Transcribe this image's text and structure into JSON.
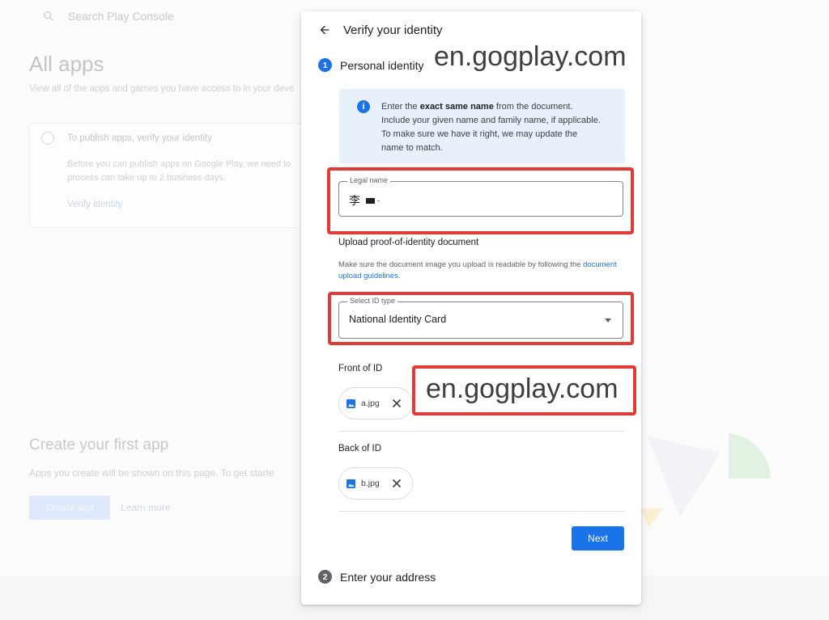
{
  "background": {
    "search_placeholder": "Search Play Console",
    "page_title": "All apps",
    "page_subtitle": "View all of the apps and games you have access to in your deve",
    "card": {
      "title": "To publish apps, verify your identity",
      "body": "Before you can publish apps on Google Play, we need to process can take up to 2 business days.",
      "link": "Verify identity"
    },
    "create_title": "Create your first app",
    "create_sub": "Apps you create will be shown on this page. To get starte",
    "create_button": "Create app",
    "learn_more": "Learn more"
  },
  "dialog": {
    "title": "Verify your identity",
    "step1": {
      "number": "1",
      "label": "Personal identity"
    },
    "info": {
      "pre": "Enter the ",
      "bold": "exact same name",
      "post": " from the document. Include your given name and family name, if applicable. To make sure we have it right, we may update the name to match."
    },
    "legal_name": {
      "label": "Legal name",
      "value_prefix": "李",
      "value_suffix": "-"
    },
    "upload": {
      "title": "Upload proof-of-identity document",
      "desc": "Make sure the document image you upload is readable by following the ",
      "link": "document upload guidelines",
      "desc_end": "."
    },
    "id_type": {
      "label": "Select ID type",
      "value": "National Identity Card"
    },
    "front": {
      "title": "Front of ID",
      "file": "a.jpg"
    },
    "back": {
      "title": "Back of ID",
      "file": "b.jpg"
    },
    "next_label": "Next",
    "step2": {
      "number": "2",
      "label": "Enter your address"
    }
  },
  "watermarks": {
    "top": "en.gogplay.com",
    "middle": "en.gogplay.com"
  },
  "colors": {
    "accent": "#1a73e8",
    "annotation": "#e53935",
    "info_bg": "#e8f0fe"
  }
}
